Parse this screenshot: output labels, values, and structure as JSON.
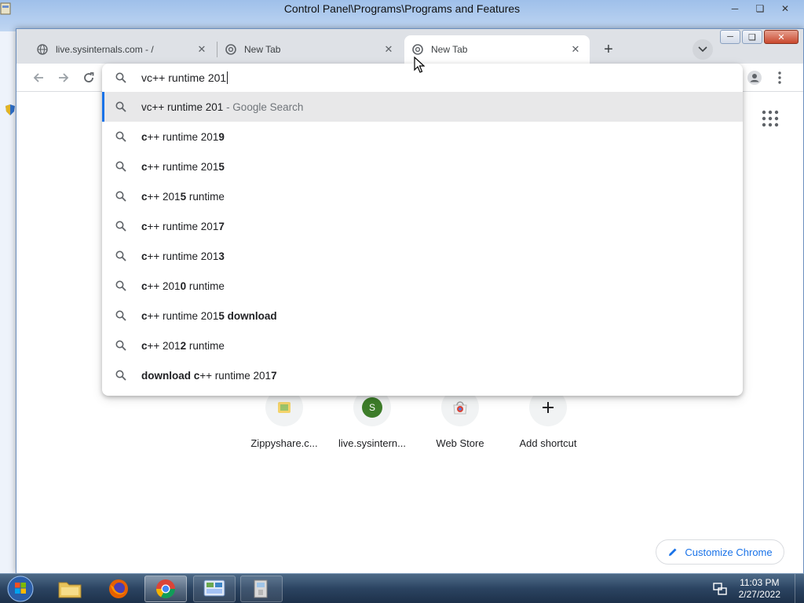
{
  "background_window": {
    "title": "Control Panel\\Programs\\Programs and Features"
  },
  "tabs": [
    {
      "title": "live.sysinternals.com - /",
      "favicon": "globe-icon",
      "active": false
    },
    {
      "title": "New Tab",
      "favicon": "chrome-icon",
      "active": false
    },
    {
      "title": "New Tab",
      "favicon": "chrome-icon",
      "active": true
    }
  ],
  "omnibox": {
    "value": "vc++ runtime 201",
    "suggestions": [
      {
        "parts": [
          {
            "t": "vc++ runtime 201",
            "b": false
          },
          {
            "t": " - Google Search",
            "dim": true
          }
        ],
        "selected": true
      },
      {
        "parts": [
          {
            "t": "c",
            "b": true
          },
          {
            "t": "++ runtime 201",
            "b": false
          },
          {
            "t": "9",
            "b": true
          }
        ]
      },
      {
        "parts": [
          {
            "t": "c",
            "b": true
          },
          {
            "t": "++ runtime 201",
            "b": false
          },
          {
            "t": "5",
            "b": true
          }
        ]
      },
      {
        "parts": [
          {
            "t": "c",
            "b": true
          },
          {
            "t": "++ 201",
            "b": false
          },
          {
            "t": "5",
            "b": true
          },
          {
            "t": " runtime",
            "b": false
          }
        ]
      },
      {
        "parts": [
          {
            "t": "c",
            "b": true
          },
          {
            "t": "++ runtime 201",
            "b": false
          },
          {
            "t": "7",
            "b": true
          }
        ]
      },
      {
        "parts": [
          {
            "t": "c",
            "b": true
          },
          {
            "t": "++ runtime 201",
            "b": false
          },
          {
            "t": "3",
            "b": true
          }
        ]
      },
      {
        "parts": [
          {
            "t": "c",
            "b": true
          },
          {
            "t": "++ 201",
            "b": false
          },
          {
            "t": "0",
            "b": true
          },
          {
            "t": " runtime",
            "b": false
          }
        ]
      },
      {
        "parts": [
          {
            "t": "c",
            "b": true
          },
          {
            "t": "++ runtime 201",
            "b": false
          },
          {
            "t": "5 download",
            "b": true
          }
        ]
      },
      {
        "parts": [
          {
            "t": "c",
            "b": true
          },
          {
            "t": "++ 201",
            "b": false
          },
          {
            "t": "2",
            "b": true
          },
          {
            "t": " runtime",
            "b": false
          }
        ]
      },
      {
        "parts": [
          {
            "t": "download c",
            "b": true
          },
          {
            "t": "++ runtime 201",
            "b": false
          },
          {
            "t": "7",
            "b": true
          }
        ]
      }
    ]
  },
  "shortcuts": [
    {
      "label": "Zippyshare.c...",
      "icon": "zippyshare-icon"
    },
    {
      "label": "live.sysintern...",
      "icon": "letter-s-icon",
      "letter": "S"
    },
    {
      "label": "Web Store",
      "icon": "webstore-icon"
    },
    {
      "label": "Add shortcut",
      "icon": "plus-icon"
    }
  ],
  "customize_label": "Customize Chrome",
  "taskbar": {
    "time": "11:03 PM",
    "date": "2/27/2022"
  },
  "colors": {
    "accent": "#1a73e8",
    "shortcut_s": "#3d7d2a"
  }
}
